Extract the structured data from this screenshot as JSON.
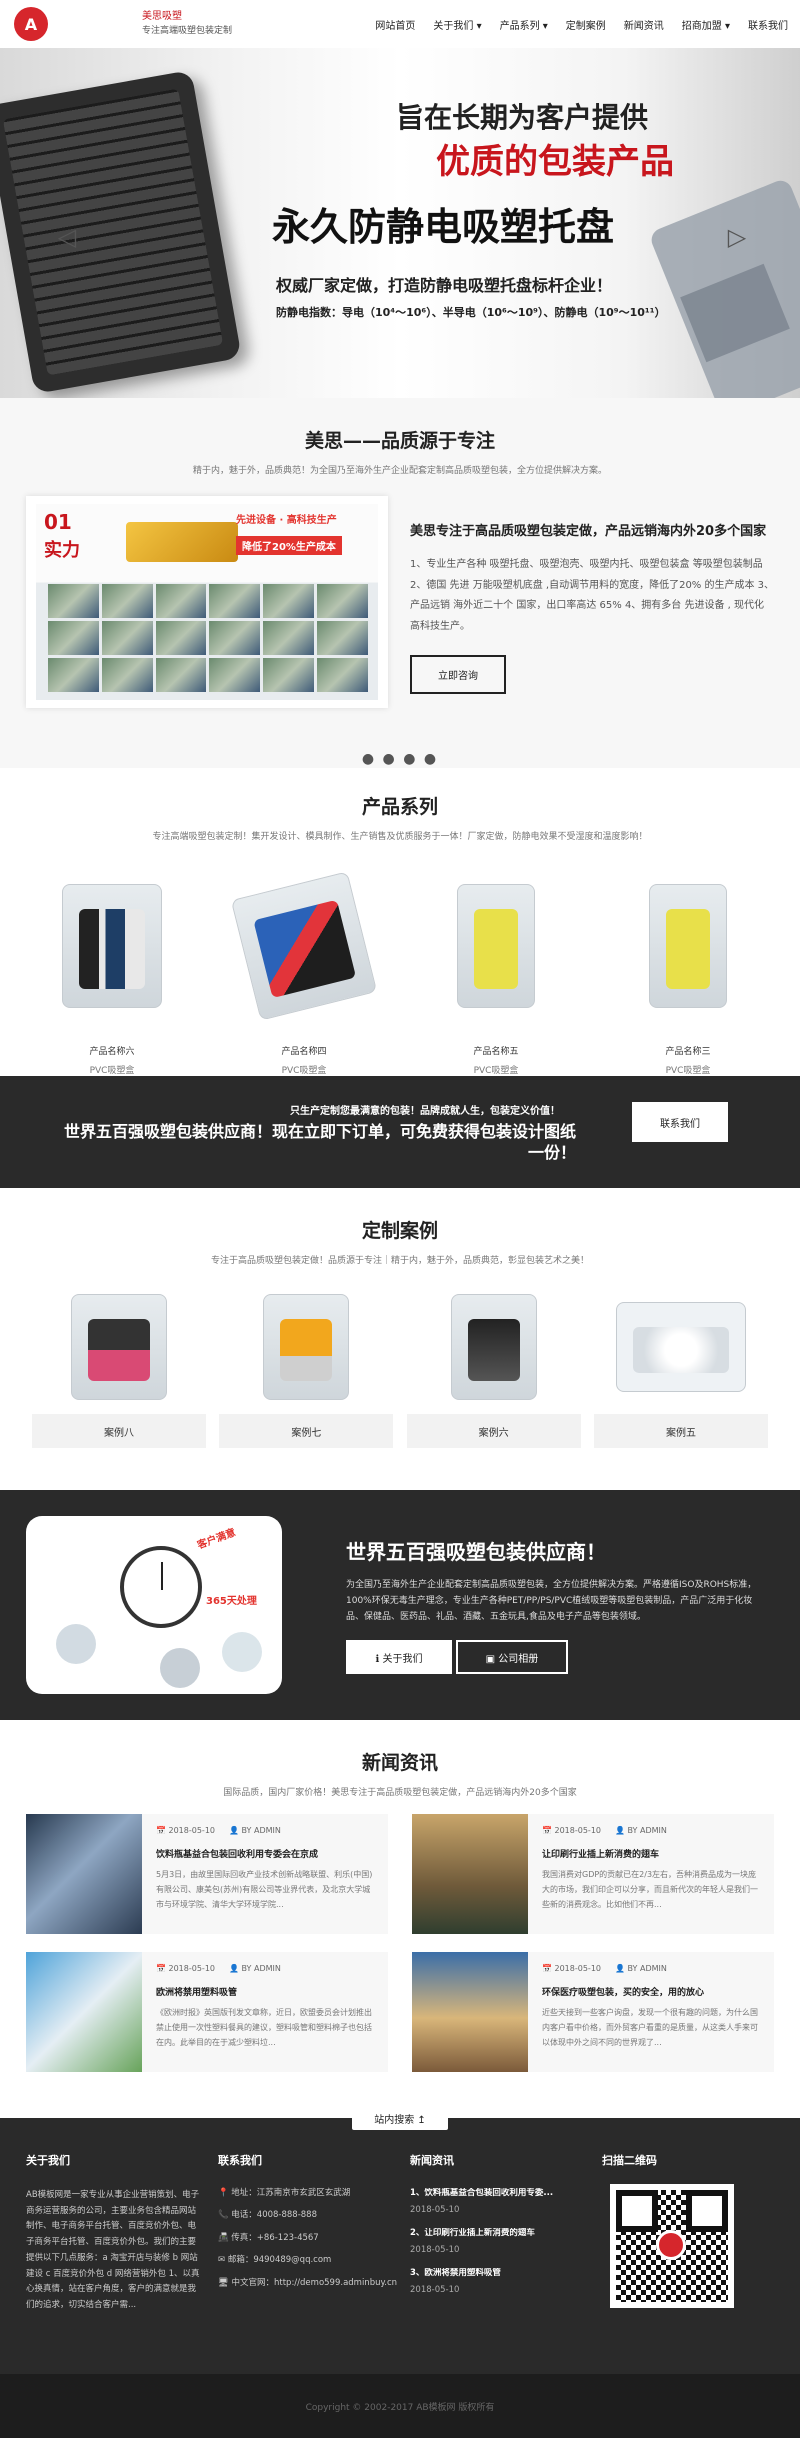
{
  "header": {
    "logo_text": "A",
    "brand_name": "美思吸塑",
    "brand_slogan": "专注高端吸塑包装定制",
    "nav": [
      "网站首页",
      "关于我们 ▾",
      "产品系列 ▾",
      "定制案例",
      "新闻资讯",
      "招商加盟 ▾",
      "联系我们"
    ]
  },
  "banner": {
    "line1": "旨在长期为客户提供",
    "line2": "优质的包装产品",
    "line3": "永久防静电吸塑托盘",
    "line4": "权威厂家定做，打造防静电吸塑托盘标杆企业！",
    "line5": "防静电指数：导电（10⁴～10⁶）、半导电（10⁶～10⁹）、防静电（10⁹～10¹¹）",
    "prev_icon": "◁",
    "next_icon": "▷"
  },
  "about": {
    "title": "美思——品质源于专注",
    "subtitle": "精于内，魅于外，品质典范！为全国乃至海外生产企业配套定制高品质吸塑包装，全方位提供解决方案。",
    "img_num": "01",
    "img_power": "实力",
    "img_tag1": "先进设备 · 高科技生产",
    "img_tag2": "降低了20%生产成本",
    "heading": "美思专注于高品质吸塑包装定做，产品远销海内外20多个国家",
    "text": "1、专业生产各种 吸塑托盘、吸塑泡壳、吸塑内托、吸塑包装盒 等吸塑包装制品 2、德国 先进 万能吸塑机底盘 ,自动调节用料的宽度，降低了20% 的生产成本 3、产品远销 海外近二十个 国家，出口率高达 65% 4、拥有多台 先进设备 , 现代化 高科技生产。",
    "button": "立即咨询",
    "dots": "● ● ● ●"
  },
  "products": {
    "title": "产品系列",
    "subtitle": "专注高端吸塑包装定制！集开发设计、模具制作、生产销售及优质服务于一体！厂家定做，防静电效果不受湿度和温度影响！",
    "items": [
      {
        "name": "产品名称六",
        "category": "PVC吸塑盒"
      },
      {
        "name": "产品名称四",
        "category": "PVC吸塑盒"
      },
      {
        "name": "产品名称五",
        "category": "PVC吸塑盒"
      },
      {
        "name": "产品名称三",
        "category": "PVC吸塑盒"
      }
    ]
  },
  "cta": {
    "small": "只生产定制您最满意的包装！品牌成就人生，包装定义价值！",
    "big": "世界五百强吸塑包装供应商！现在立即下订单，可免费获得包装设计图纸一份！",
    "button": "联系我们"
  },
  "cases": {
    "title": "定制案例",
    "subtitle": "专注于高品质吸塑包装定做！品质源于专注｜精于内，魅于外，品质典范，彰显包装艺术之美！",
    "items": [
      "案例八",
      "案例七",
      "案例六",
      "案例五"
    ]
  },
  "supplier": {
    "title": "世界五百强吸塑包装供应商！",
    "desc": "为全国乃至海外生产企业配套定制高品质吸塑包装，全方位提供解决方案。严格遵循ISO及ROHS标准，100%环保无毒生产理念，专业生产各种PET/PP/PS/PVC植绒吸塑等吸塑包装制品，产品广泛用于化妆品、保健品、医药品、礼品、酒藏、五金玩具,食品及电子产品等包装领域。",
    "img_text1": "客户满意",
    "img_text2": "365天处理",
    "btn_about": "ℹ 关于我们",
    "btn_album": "▣ 公司相册"
  },
  "news": {
    "title": "新闻资讯",
    "subtitle": "国际品质，国内厂家价格！美思专注于高品质吸塑包装定做，产品远销海内外20多个国家",
    "items": [
      {
        "date": "📅 2018-05-10",
        "author": "👤 BY ADMIN",
        "title": "饮料瓶基益合包装回收利用专委会在京成",
        "summary": "5月3日，由故里国际回收产业技术创新战略联盟、利乐(中国)有限公司、康美包(苏州)有限公司等业界代表，及北京大学城市与环境学院、清华大学环境学院..."
      },
      {
        "date": "📅 2018-05-10",
        "author": "👤 BY ADMIN",
        "title": "让印刷行业插上新消费的翅车",
        "summary": "我国消费对GDP的贡献已在2/3左右，吾种消费品成为一块庞大的市场，我们印企可以分享，而且新代次的年轻人是我们一些新的消费观念。比如他们不再..."
      },
      {
        "date": "📅 2018-05-10",
        "author": "👤 BY ADMIN",
        "title": "欧洲将禁用塑料吸管",
        "summary": "《欧洲时报》英国版刊发文章称，近日，欧盟委员会计划推出禁止使用一次性塑料餐具的建议，塑料吸管和塑料棉子也包括在内。此举目的在于减少塑料垃..."
      },
      {
        "date": "📅 2018-05-10",
        "author": "👤 BY ADMIN",
        "title": "环保医疗吸塑包装，买的安全，用的放心",
        "summary": "近些天接到一些客户询盘，发现一个很有趣的问题，为什么国内客户看中价格，而外贸客户看重的是质量，从这类人手来可以体现中外之间不同的世界观了..."
      }
    ]
  },
  "footer": {
    "search_tab": "站内搜索 ↥",
    "about_title": "关于我们",
    "about_text": "AB模板网是一家专业从事企业营销策划、电子商务运营服务的公司，主要业务包含精品网站制作、电子商务平台托管、百度竞价外包、电子商务平台托管、百度竞价外包。我们的主要提供以下几点服务：a 淘宝开店与装修 b 网站建设 c 百度竞价外包 d 网络营销外包 1、以真心换真情，站在客户角度，客户的满意就是我们的追求，切实结合客户需...",
    "contact_title": "联系我们",
    "contact": [
      "📍 地址：江苏南京市玄武区玄武湖",
      "📞 电话：4008-888-888",
      "📠 传真：+86-123-4567",
      "✉ 邮箱：9490489@qq.com",
      "🖥 中文官网：http://demo599.adminbuy.cn"
    ],
    "news_title": "新闻资讯",
    "news": [
      {
        "title": "1、饮料瓶基益合包装回收利用专委...",
        "date": "2018-05-10"
      },
      {
        "title": "2、让印刷行业插上新消费的翅车",
        "date": "2018-05-10"
      },
      {
        "title": "3、欧洲将禁用塑料吸管",
        "date": "2018-05-10"
      }
    ],
    "qr_title": "扫描二维码",
    "copyright": "Copyright © 2002-2017 AB模板网 版权所有"
  },
  "colors": {
    "brand_red": "#c8161d",
    "dark_bg": "#2a2a2a"
  }
}
